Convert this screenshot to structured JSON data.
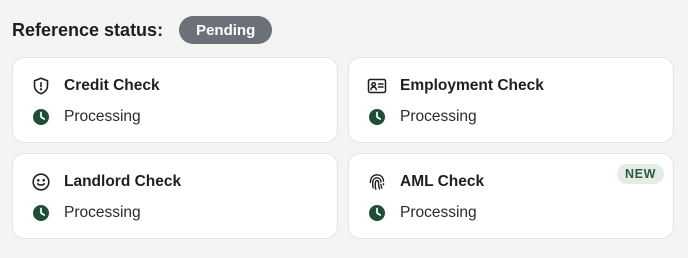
{
  "header": {
    "title": "Reference status:",
    "status": "Pending"
  },
  "cards": [
    {
      "title": "Credit Check",
      "icon": "shield-alert-icon",
      "status": "Processing"
    },
    {
      "title": "Employment Check",
      "icon": "id-card-icon",
      "status": "Processing"
    },
    {
      "title": "Landlord Check",
      "icon": "smiley-icon",
      "status": "Processing"
    },
    {
      "title": "AML Check",
      "icon": "fingerprint-icon",
      "status": "Processing",
      "badge": "NEW"
    }
  ],
  "colors": {
    "processing_icon": "#1f4d36",
    "pill_bg": "#6b7079",
    "badge_bg": "#e3ede6",
    "badge_text": "#2f5a42"
  }
}
